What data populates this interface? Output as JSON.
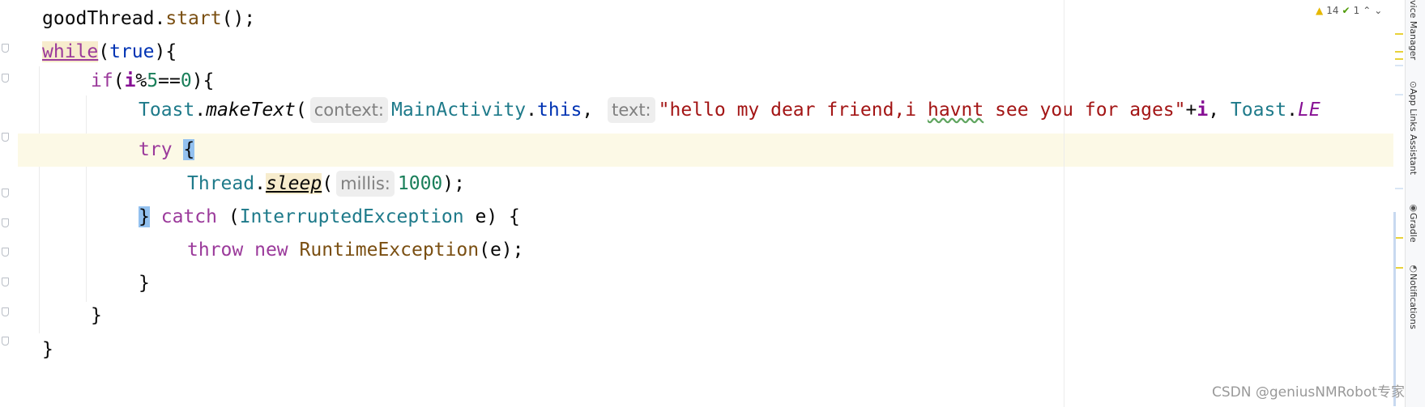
{
  "code_lines": [
    {
      "id": "l1"
    },
    {
      "id": "l2"
    }
  ],
  "tokens": {
    "goodThread": "goodThread",
    "dot": ".",
    "start": "start",
    "paren_semi": "();",
    "while": "while",
    "lp": "(",
    "true": "true",
    "rp_brace": "){",
    "if": "if",
    "i": "i",
    "mod": "%",
    "five": "5",
    "eqeq": "==",
    "zero": "0",
    "Toast": "Toast",
    "makeText": "makeText",
    "hint_context": "context:",
    "MainActivity": "MainActivity",
    "this": "this",
    "comma_sp": ", ",
    "hint_text": "text:",
    "string_literal_a": "\"hello my dear friend,i ",
    "string_literal_typo": "havnt",
    "string_literal_b": " see you for ages\"",
    "plus": "+",
    "LE": "LE",
    "try": "try",
    "brace_open": "{",
    "Thread": "Thread",
    "sleep": "sleep",
    "hint_millis": "millis:",
    "thousand": "1000",
    "rp_semi": ");",
    "brace_close": "}",
    "catch": "catch",
    "InterruptedException": "InterruptedException",
    "e": "e",
    "rp_sp_brace": ") {",
    "throw": "throw",
    "new": "new",
    "RuntimeException": "RuntimeException",
    "e_rp_semi": "e);"
  },
  "status": {
    "warnings": "14",
    "checks": "1",
    "up_arrow": "⌃",
    "down_arrow": "⌄"
  },
  "side_panel": {
    "device_manager": "vice Manager",
    "app_links": "App Links Assistant",
    "gradle": "Gradle",
    "notifications": "Notifications"
  },
  "watermark": "CSDN @geniusNMRobot专家",
  "colors": {
    "current_line": "#fcf9e6",
    "keyword": "#0033b3",
    "string": "#a31515",
    "brace_match": "#93c1ef"
  }
}
